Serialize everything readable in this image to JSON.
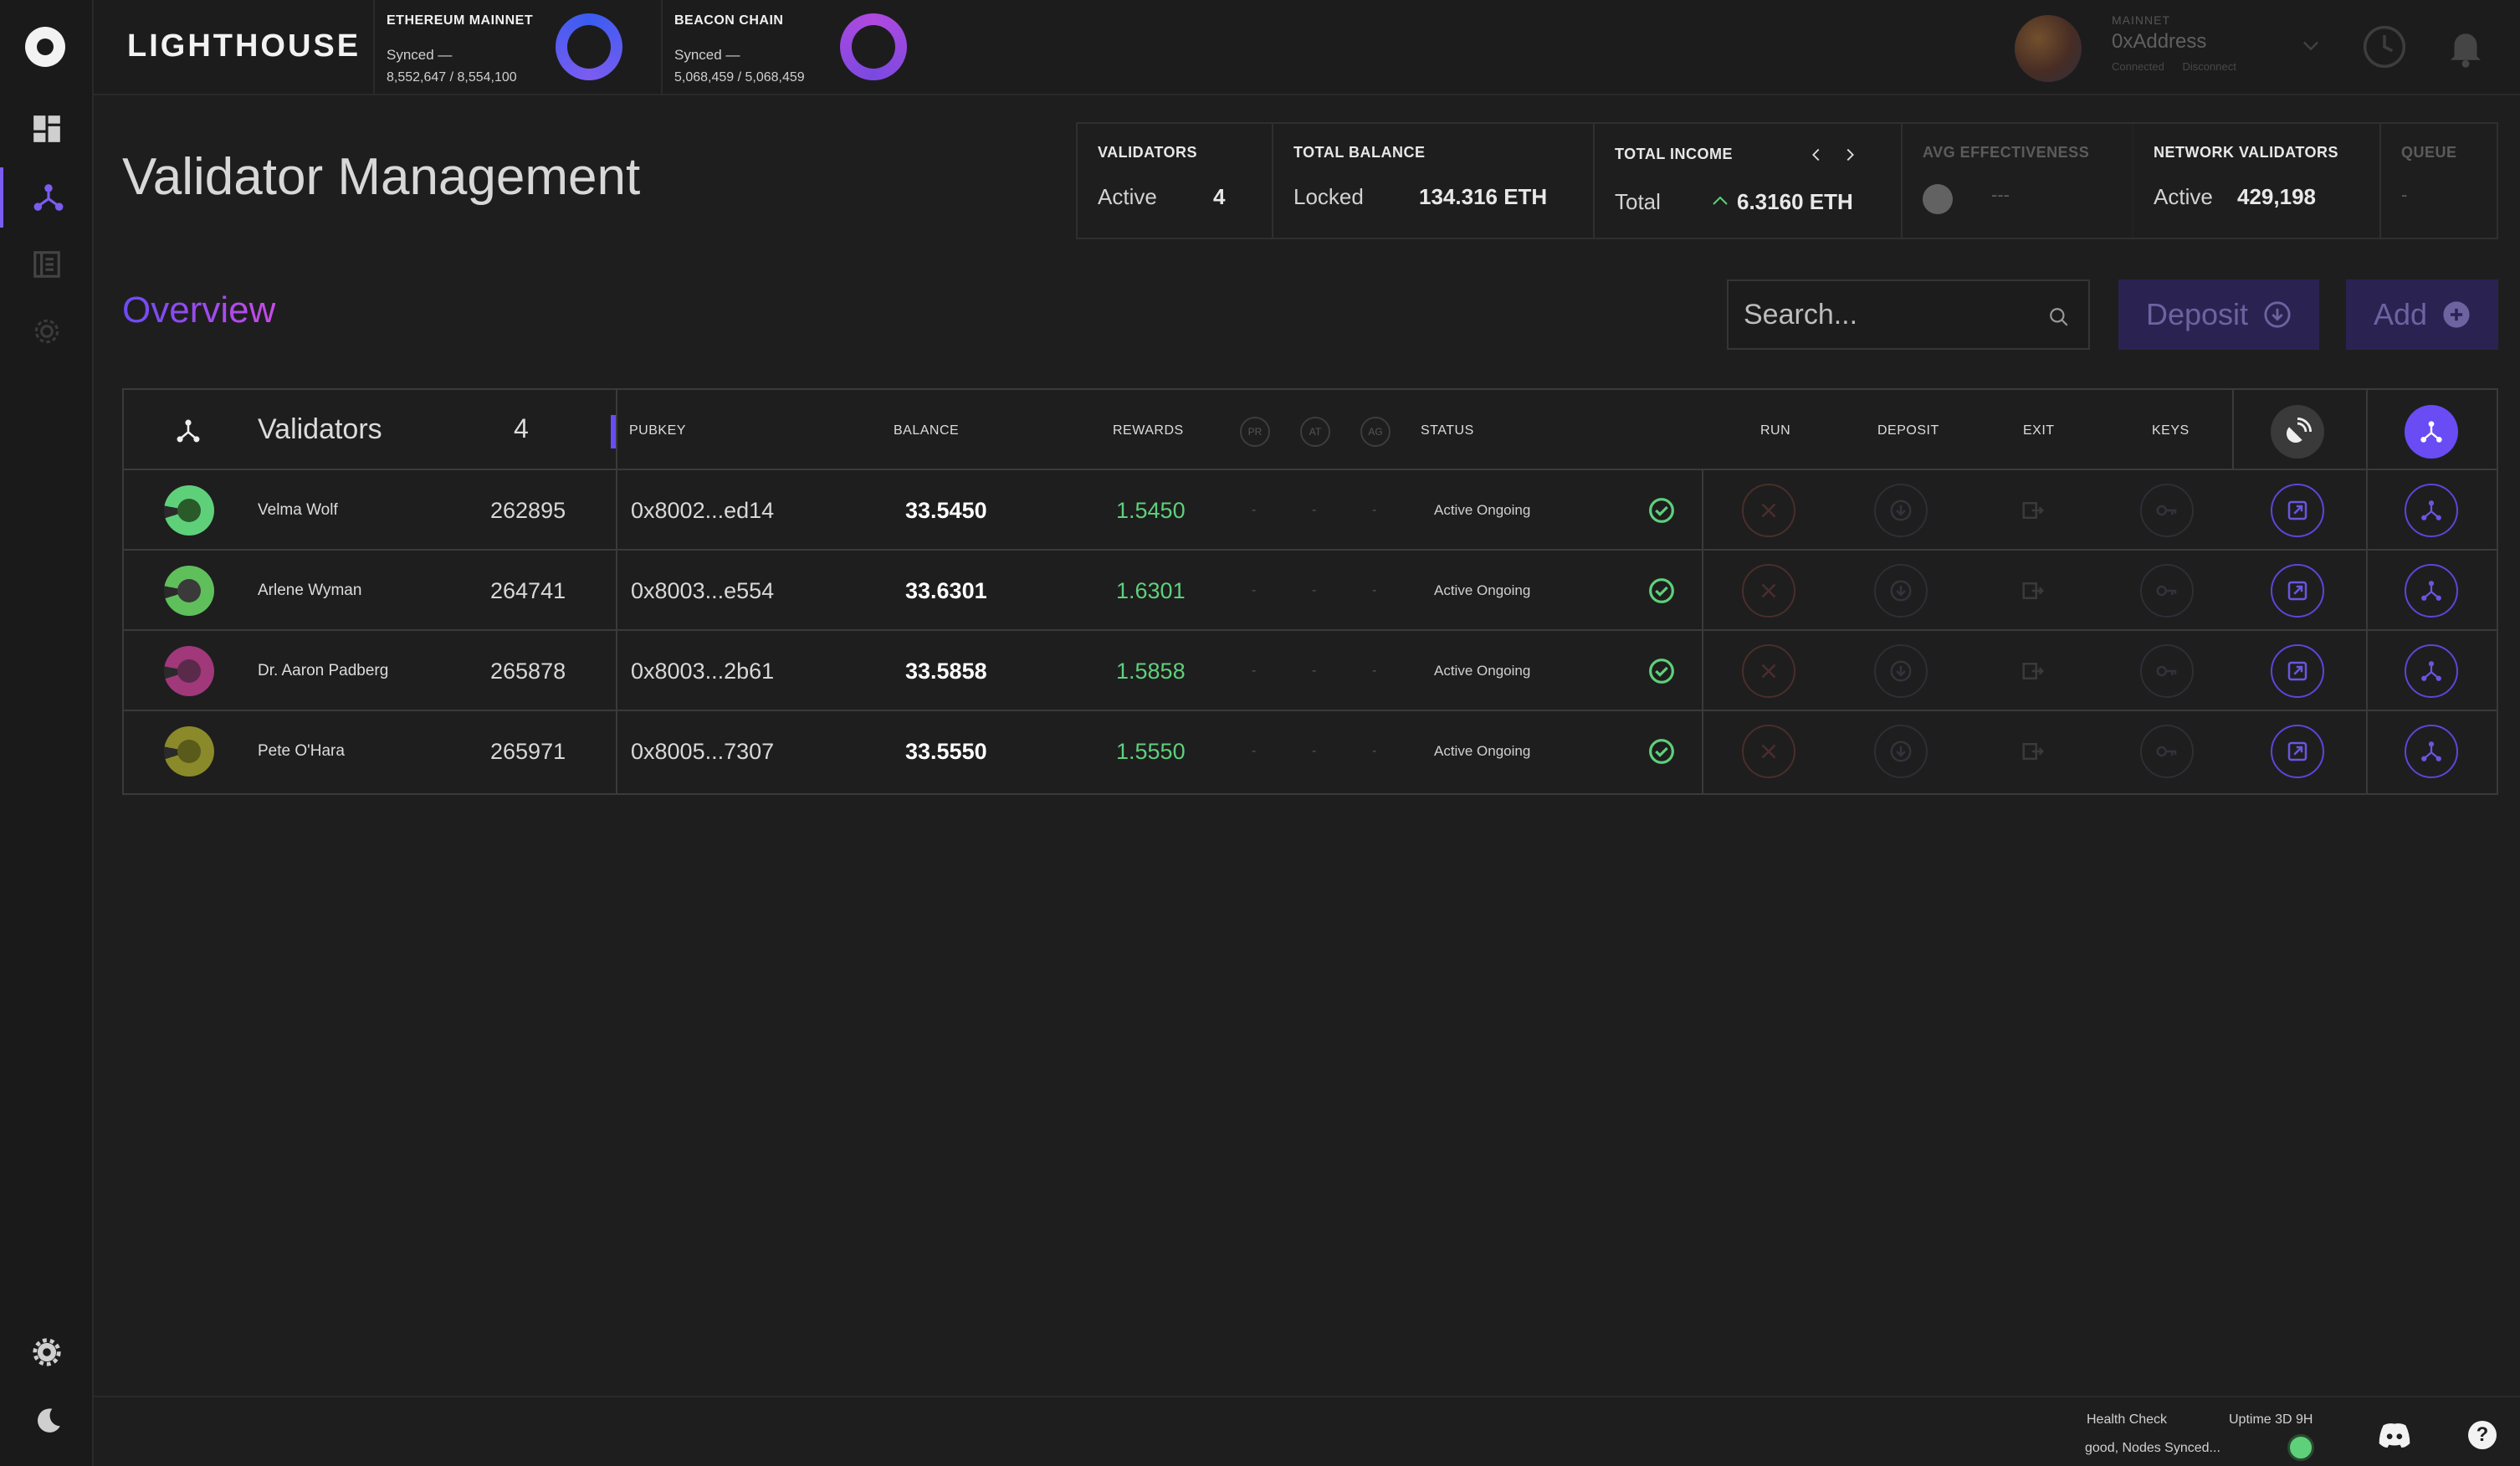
{
  "brand": "LIGHTHOUSE",
  "chains": [
    {
      "title": "ETHEREUM MAINNET",
      "status": "Synced —",
      "progress": "8,552,647 / 8,554,100",
      "ring_color": "#3b5cf0"
    },
    {
      "title": "BEACON CHAIN",
      "status": "Synced —",
      "progress": "5,068,459 / 5,068,459",
      "ring_color": "#b049e0"
    }
  ],
  "account": {
    "network": "MAINNET",
    "address": "0xAddress",
    "connected": "Connected",
    "disconnect": "Disconnect"
  },
  "page": {
    "title": "Validator Management",
    "section": "Overview"
  },
  "stats": {
    "validators": {
      "label": "VALIDATORS",
      "sub": "Active",
      "value": "4"
    },
    "total_balance": {
      "label": "TOTAL BALANCE",
      "sub": "Locked",
      "value": "134.316 ETH"
    },
    "total_income": {
      "label": "TOTAL INCOME",
      "sub": "Total",
      "value": "6.3160 ETH"
    },
    "avg_effectiveness": {
      "label": "AVG EFFECTIVENESS",
      "value": "---"
    },
    "network_validators": {
      "label": "NETWORK VALIDATORS",
      "sub": "Active",
      "value": "429,198"
    },
    "queue": {
      "label": "QUEUE",
      "value": "-"
    }
  },
  "toolbar": {
    "search_placeholder": "Search...",
    "deposit_label": "Deposit",
    "add_label": "Add"
  },
  "table": {
    "title": "Validators",
    "count": "4",
    "headers": {
      "pubkey": "PUBKEY",
      "balance": "BALANCE",
      "rewards": "REWARDS",
      "pr": "PR",
      "at": "AT",
      "ag": "AG",
      "status": "STATUS",
      "run": "RUN",
      "deposit": "DEPOSIT",
      "exit": "EXIT",
      "keys": "KEYS"
    },
    "rows": [
      {
        "name": "Velma Wolf",
        "index": "262895",
        "pubkey": "0x8002...ed14",
        "balance": "33.5450",
        "rewards": "1.5450",
        "pr": "-",
        "at": "-",
        "ag": "-",
        "status": "Active Ongoing",
        "avatar_color": "#5fd07a",
        "avatar_inner": "#2a5a2a"
      },
      {
        "name": "Arlene Wyman",
        "index": "264741",
        "pubkey": "0x8003...e554",
        "balance": "33.6301",
        "rewards": "1.6301",
        "pr": "-",
        "at": "-",
        "ag": "-",
        "status": "Active Ongoing",
        "avatar_color": "#5fbf5a",
        "avatar_inner": "#3a3a3a"
      },
      {
        "name": "Dr. Aaron Padberg",
        "index": "265878",
        "pubkey": "0x8003...2b61",
        "balance": "33.5858",
        "rewards": "1.5858",
        "pr": "-",
        "at": "-",
        "ag": "-",
        "status": "Active Ongoing",
        "avatar_color": "#a0387a",
        "avatar_inner": "#5a2a4a"
      },
      {
        "name": "Pete O'Hara",
        "index": "265971",
        "pubkey": "0x8005...7307",
        "balance": "33.5550",
        "rewards": "1.5550",
        "pr": "-",
        "at": "-",
        "ag": "-",
        "status": "Active Ongoing",
        "avatar_color": "#8a8a2a",
        "avatar_inner": "#5a5a1a"
      }
    ]
  },
  "footer": {
    "health": "Health Check",
    "uptime": "Uptime 3D 9H",
    "synced": "good, Nodes Synced..."
  },
  "colors": {
    "accent": "#7b5cf0",
    "positive": "#5fd07a",
    "danger": "#6a2e28"
  }
}
